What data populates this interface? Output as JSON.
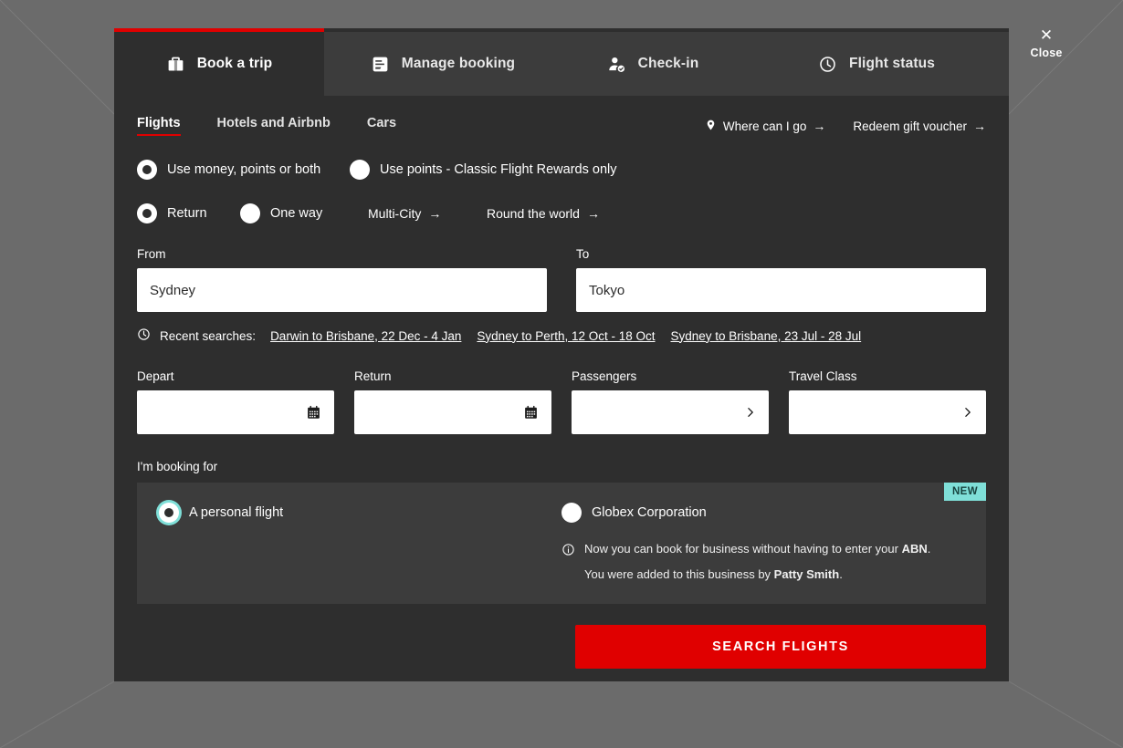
{
  "overlay": {
    "close_label": "Close",
    "close_icon": "close-x-icon"
  },
  "theme": {
    "accent_red": "#e00000",
    "panel_dark": "#2e2e2e",
    "panel_light": "#3c3c3c",
    "teal": "#7fdfd8",
    "overlay_gray": "#6b6b6b"
  },
  "tabs": [
    {
      "label": "Book a trip",
      "icon": "briefcase-icon",
      "active": true
    },
    {
      "label": "Manage booking",
      "icon": "document-edit-icon",
      "active": false
    },
    {
      "label": "Check-in",
      "icon": "person-check-icon",
      "active": false
    },
    {
      "label": "Flight status",
      "icon": "clock-icon",
      "active": false
    }
  ],
  "subtabs": [
    {
      "label": "Flights",
      "active": true
    },
    {
      "label": "Hotels and Airbnb",
      "active": false
    },
    {
      "label": "Cars",
      "active": false
    }
  ],
  "quick_links": [
    {
      "label": "Where can I go",
      "icon": "location-pin-icon",
      "arrow": "→"
    },
    {
      "label": "Redeem gift voucher",
      "icon": "",
      "arrow": "→"
    }
  ],
  "payment_options": [
    {
      "label": "Use money, points or both",
      "selected": true
    },
    {
      "label": "Use points - Classic Flight Rewards only",
      "selected": false
    }
  ],
  "trip_types": [
    {
      "label": "Return",
      "selected": true,
      "type": "radio"
    },
    {
      "label": "One way",
      "selected": false,
      "type": "radio"
    },
    {
      "label": "Multi-City",
      "arrow": "→",
      "type": "link"
    },
    {
      "label": "Round the world",
      "arrow": "→",
      "type": "link"
    }
  ],
  "route": {
    "from": {
      "label": "From",
      "value": "Sydney",
      "placeholder": "From"
    },
    "to": {
      "label": "To",
      "value": "Tokyo",
      "placeholder": "To"
    }
  },
  "recent_searches": {
    "icon": "clock-icon",
    "label": "Recent searches:",
    "items": [
      "Darwin to Brisbane, 22 Dec - 4 Jan",
      "Sydney to Perth, 12 Oct - 18 Oct",
      "Sydney to Brisbane, 23 Jul - 28 Jul"
    ]
  },
  "detail_fields": [
    {
      "label": "Depart",
      "value": "",
      "icon": "calendar-icon"
    },
    {
      "label": "Return",
      "value": "",
      "icon": "calendar-icon"
    },
    {
      "label": "Passengers",
      "value": "",
      "icon": "chevron-right-icon"
    },
    {
      "label": "Travel Class",
      "value": "",
      "icon": "chevron-right-icon"
    }
  ],
  "booking_for": {
    "label": "I'm booking for",
    "badge": "NEW",
    "options": [
      {
        "label": "A personal flight",
        "selected": true
      },
      {
        "label": "Globex Corporation",
        "selected": false
      }
    ],
    "note_icon": "info-icon",
    "note_line1_a": "Now you can book for business without having to enter your ",
    "note_line1_b": "ABN",
    "note_line1_c": ".",
    "note_line2_a": "You were added to this business by ",
    "note_line2_b": "Patty Smith",
    "note_line2_c": "."
  },
  "search_button": {
    "label": "SEARCH FLIGHTS"
  }
}
